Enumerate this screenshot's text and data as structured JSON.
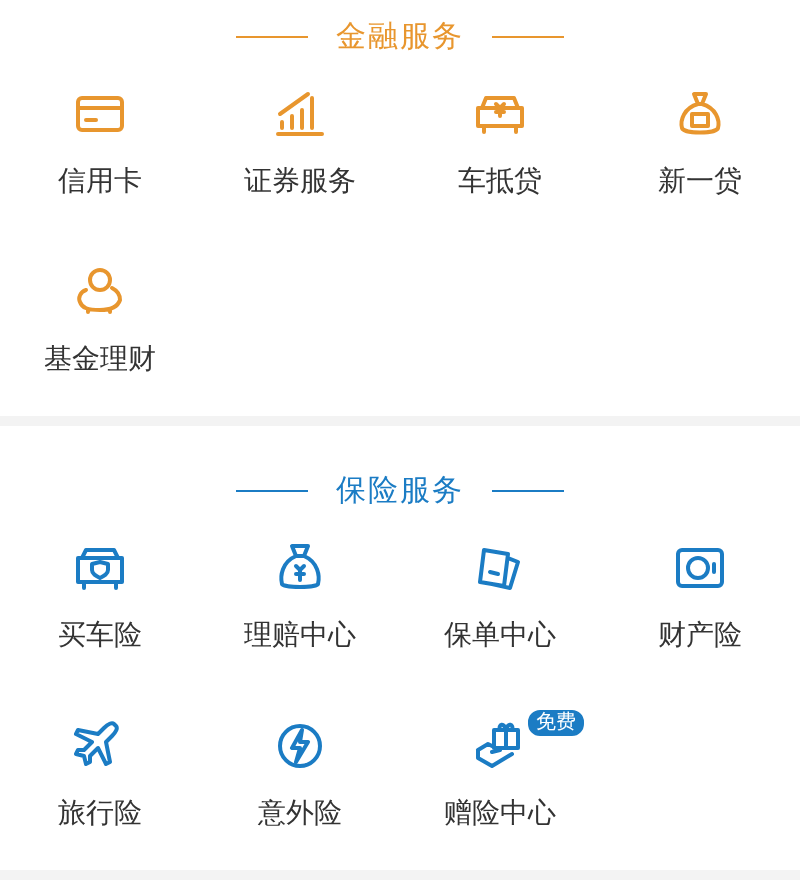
{
  "sections": [
    {
      "title": "金融服务",
      "color": "#e8962e",
      "items": [
        {
          "label": "信用卡"
        },
        {
          "label": "证券服务"
        },
        {
          "label": "车抵贷"
        },
        {
          "label": "新一贷"
        },
        {
          "label": "基金理财"
        }
      ]
    },
    {
      "title": "保险服务",
      "color": "#1b7cc4",
      "items": [
        {
          "label": "买车险"
        },
        {
          "label": "理赔中心"
        },
        {
          "label": "保单中心"
        },
        {
          "label": "财产险"
        },
        {
          "label": "旅行险"
        },
        {
          "label": "意外险"
        },
        {
          "label": "赠险中心",
          "badge": "免费"
        }
      ]
    }
  ]
}
